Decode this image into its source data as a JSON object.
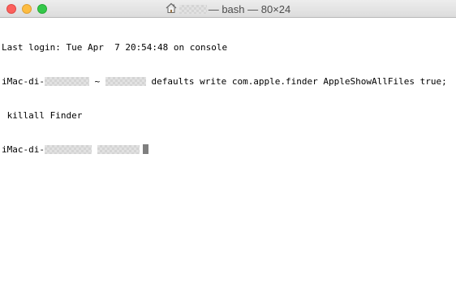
{
  "window": {
    "title_suffix": " — bash — 80×24"
  },
  "terminal": {
    "line1": "Last login: Tue Apr  7 20:54:48 on console",
    "prompt_prefix": "iMac-di-",
    "prompt_tilde": " ~ ",
    "command": " defaults write com.apple.finder AppleShowAllFiles true;",
    "line3": " killall Finder",
    "prompt2_prefix": "iMac-di-"
  }
}
